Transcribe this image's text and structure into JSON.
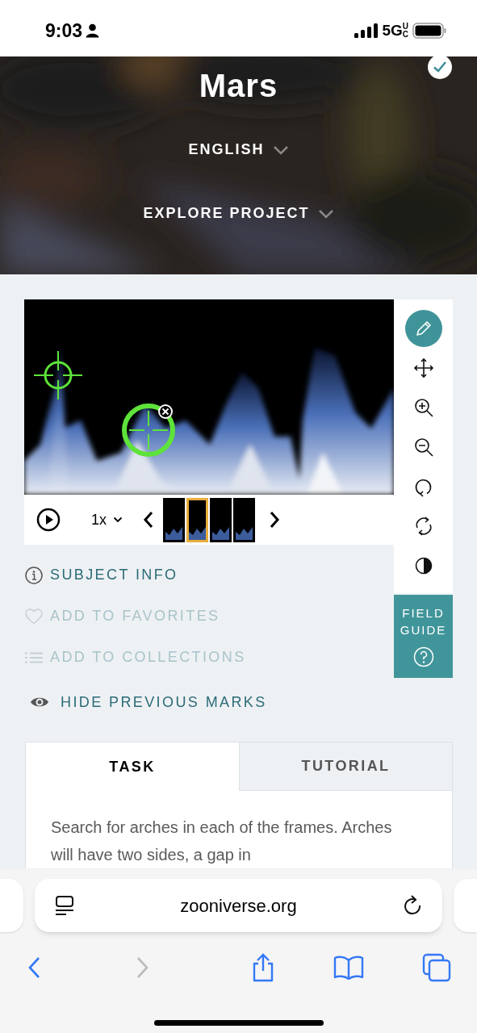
{
  "status_bar": {
    "time": "9:03",
    "network": "5G",
    "network_suffix_top": "U",
    "network_suffix_bottom": "C"
  },
  "header": {
    "title": "Mars",
    "checked": true,
    "menus": [
      {
        "label": "ENGLISH"
      },
      {
        "label": "EXPLORE PROJECT"
      }
    ]
  },
  "viewer": {
    "speed": "1x",
    "frames": [
      {
        "selected": false
      },
      {
        "selected": true
      },
      {
        "selected": false
      },
      {
        "selected": false
      }
    ]
  },
  "tools": [
    {
      "kind": "draw",
      "selected": true
    },
    {
      "kind": "move",
      "selected": false
    },
    {
      "kind": "zoom_in",
      "selected": false
    },
    {
      "kind": "zoom_out",
      "selected": false
    },
    {
      "kind": "rotate",
      "selected": false
    },
    {
      "kind": "reset",
      "selected": false
    },
    {
      "kind": "invert",
      "selected": false
    }
  ],
  "field_guide": {
    "label": "FIELD GUIDE"
  },
  "actions": [
    {
      "kind": "info",
      "label": "SUBJECT INFO",
      "disabled": false
    },
    {
      "kind": "favorite",
      "label": "ADD TO FAVORITES",
      "disabled": true
    },
    {
      "kind": "collections",
      "label": "ADD TO COLLECTIONS",
      "disabled": true
    }
  ],
  "marks_toggle": {
    "label": "HIDE PREVIOUS MARKS"
  },
  "tabs": [
    {
      "label": "TASK",
      "selected": true
    },
    {
      "label": "TUTORIAL",
      "selected": false
    }
  ],
  "task": {
    "text": "Search for arches in each of the frames. Arches will have two sides, a gap in"
  },
  "browser": {
    "url": "zooniverse.org",
    "back_enabled": true,
    "forward_enabled": false
  }
}
